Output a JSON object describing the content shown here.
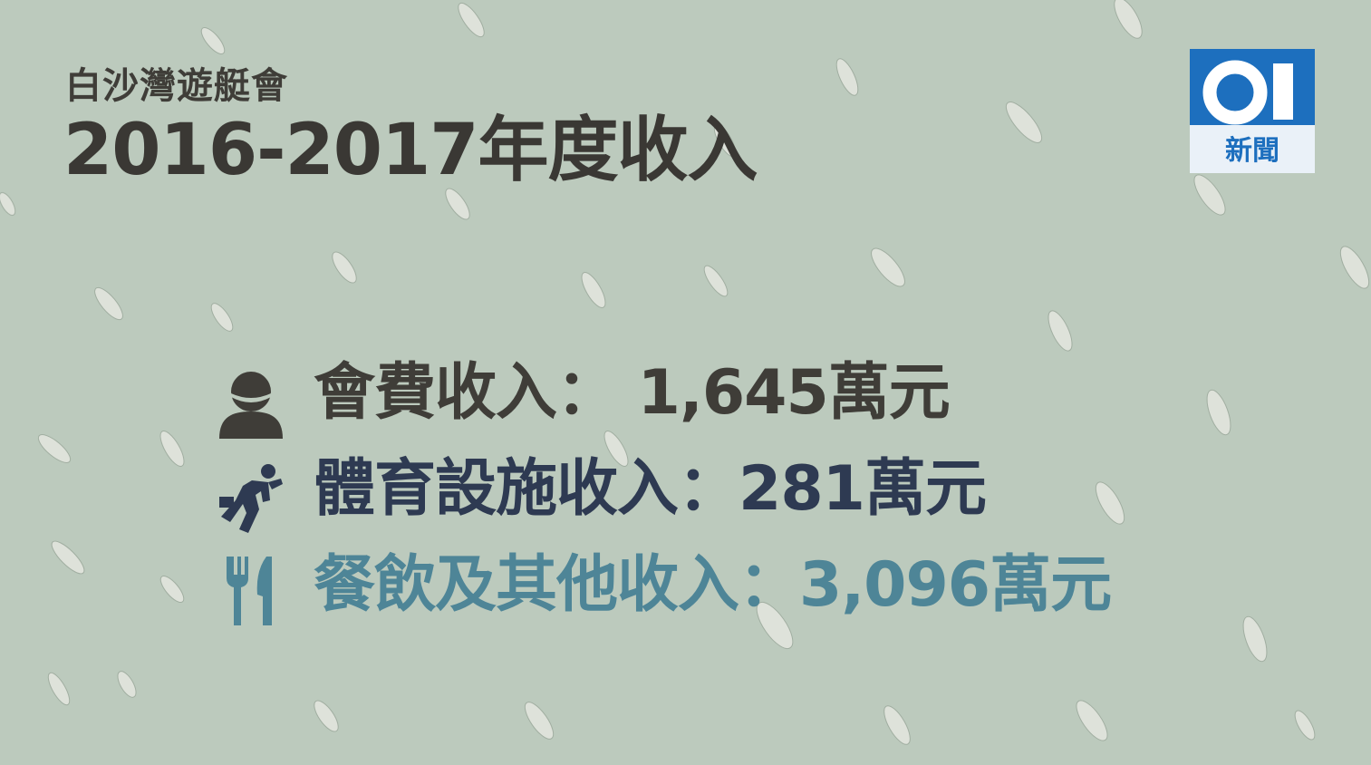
{
  "header": {
    "subtitle": "白沙灣遊艇會",
    "title": "2016-2017年度收入"
  },
  "logo": {
    "number": "01",
    "label": "新聞",
    "colors": {
      "blue": "#1d6fbe",
      "light": "#eaf1f8"
    }
  },
  "income": [
    {
      "icon": "person-icon",
      "text": "會費收入： 1,645萬元",
      "color": "#3f3d38"
    },
    {
      "icon": "runner-icon",
      "text": "體育設施收入：281萬元",
      "color": "#2e3a52"
    },
    {
      "icon": "fork-knife-icon",
      "text": "餐飲及其他收入：3,096萬元",
      "color": "#4e8597"
    }
  ],
  "colors": {
    "background": "#bccabd",
    "title": "#3a3834"
  }
}
